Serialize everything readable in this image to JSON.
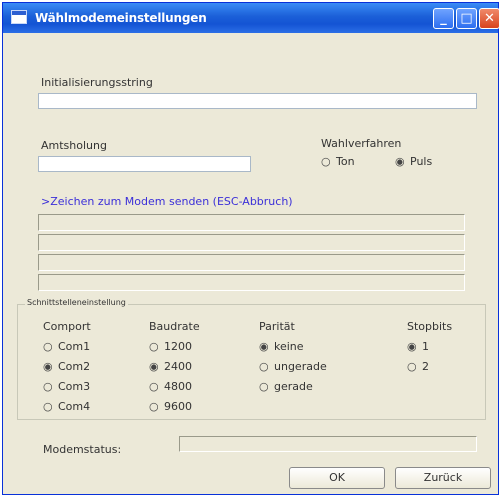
{
  "window": {
    "title": "Wählmodemeinstellungen",
    "controls": {
      "minimize": "_",
      "maximize": "□",
      "close": "✕"
    }
  },
  "init": {
    "label": "Initialisierungsstring",
    "value": ""
  },
  "amt": {
    "label": "Amtsholung",
    "value": ""
  },
  "dial": {
    "label": "Wahlverfahren",
    "options": [
      {
        "label": "Ton",
        "selected": false
      },
      {
        "label": "Puls",
        "selected": true
      }
    ]
  },
  "modem": {
    "send_label": ">Zeichen zum Modem senden (ESC-Abbruch)"
  },
  "serial": {
    "title": "Schnittstelleneinstellung",
    "comport": {
      "label": "Comport",
      "options": [
        {
          "label": "Com1",
          "selected": false
        },
        {
          "label": "Com2",
          "selected": true
        },
        {
          "label": "Com3",
          "selected": false
        },
        {
          "label": "Com4",
          "selected": false
        }
      ]
    },
    "baud": {
      "label": "Baudrate",
      "options": [
        {
          "label": "1200",
          "selected": false
        },
        {
          "label": "2400",
          "selected": true
        },
        {
          "label": "4800",
          "selected": false
        },
        {
          "label": "9600",
          "selected": false
        }
      ]
    },
    "parity": {
      "label": "Parität",
      "options": [
        {
          "label": "keine",
          "selected": true
        },
        {
          "label": "ungerade",
          "selected": false
        },
        {
          "label": "gerade",
          "selected": false
        }
      ]
    },
    "stopbits": {
      "label": "Stopbits",
      "options": [
        {
          "label": "1",
          "selected": true
        },
        {
          "label": "2",
          "selected": false
        }
      ]
    }
  },
  "status": {
    "label": "Modemstatus:"
  },
  "buttons": {
    "ok": "OK",
    "back": "Zurück"
  }
}
